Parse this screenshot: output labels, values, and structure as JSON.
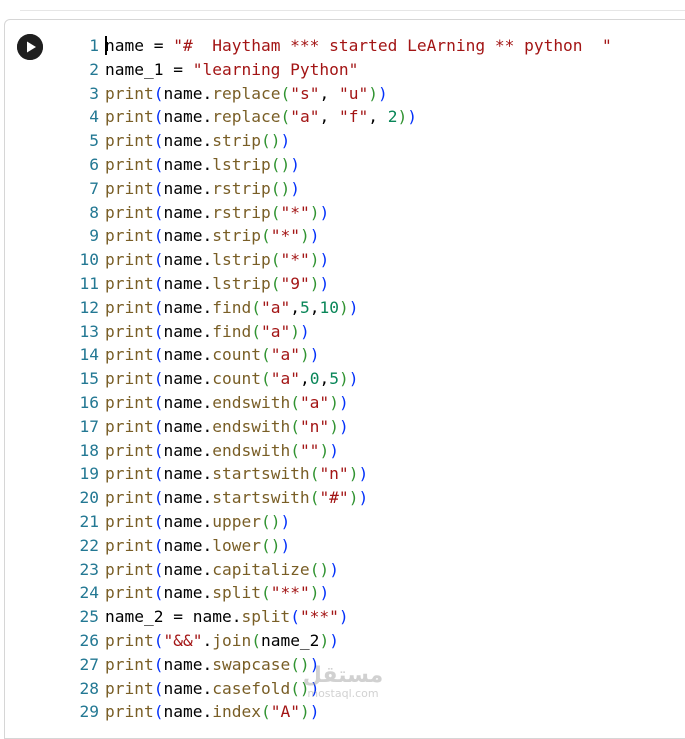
{
  "cell": {
    "run_button_icon": "play-circle-icon",
    "lines": [
      {
        "num": "1",
        "tokens": [
          [
            "plain",
            "name = "
          ],
          [
            "str",
            "\"#  Haytham *** started LeArning ** python  \""
          ]
        ]
      },
      {
        "num": "2",
        "tokens": [
          [
            "plain",
            "name_1 = "
          ],
          [
            "str",
            "\"learning Python\""
          ]
        ]
      },
      {
        "num": "3",
        "tokens": [
          [
            "fn",
            "print"
          ],
          [
            "p1",
            "("
          ],
          [
            "plain",
            "name."
          ],
          [
            "fn",
            "replace"
          ],
          [
            "p2",
            "("
          ],
          [
            "str",
            "\"s\""
          ],
          [
            "plain",
            ", "
          ],
          [
            "str",
            "\"u\""
          ],
          [
            "p2",
            ")"
          ],
          [
            "p1",
            ")"
          ]
        ]
      },
      {
        "num": "4",
        "tokens": [
          [
            "fn",
            "print"
          ],
          [
            "p1",
            "("
          ],
          [
            "plain",
            "name."
          ],
          [
            "fn",
            "replace"
          ],
          [
            "p2",
            "("
          ],
          [
            "str",
            "\"a\""
          ],
          [
            "plain",
            ", "
          ],
          [
            "str",
            "\"f\""
          ],
          [
            "plain",
            ", "
          ],
          [
            "num",
            "2"
          ],
          [
            "p2",
            ")"
          ],
          [
            "p1",
            ")"
          ]
        ]
      },
      {
        "num": "5",
        "tokens": [
          [
            "fn",
            "print"
          ],
          [
            "p1",
            "("
          ],
          [
            "plain",
            "name."
          ],
          [
            "fn",
            "strip"
          ],
          [
            "p2",
            "()"
          ],
          [
            "p1",
            ")"
          ]
        ]
      },
      {
        "num": "6",
        "tokens": [
          [
            "fn",
            "print"
          ],
          [
            "p1",
            "("
          ],
          [
            "plain",
            "name."
          ],
          [
            "fn",
            "lstrip"
          ],
          [
            "p2",
            "()"
          ],
          [
            "p1",
            ")"
          ]
        ]
      },
      {
        "num": "7",
        "tokens": [
          [
            "fn",
            "print"
          ],
          [
            "p1",
            "("
          ],
          [
            "plain",
            "name."
          ],
          [
            "fn",
            "rstrip"
          ],
          [
            "p2",
            "()"
          ],
          [
            "p1",
            ")"
          ]
        ]
      },
      {
        "num": "8",
        "tokens": [
          [
            "fn",
            "print"
          ],
          [
            "p1",
            "("
          ],
          [
            "plain",
            "name."
          ],
          [
            "fn",
            "rstrip"
          ],
          [
            "p2",
            "("
          ],
          [
            "str",
            "\"*\""
          ],
          [
            "p2",
            ")"
          ],
          [
            "p1",
            ")"
          ]
        ]
      },
      {
        "num": "9",
        "tokens": [
          [
            "fn",
            "print"
          ],
          [
            "p1",
            "("
          ],
          [
            "plain",
            "name."
          ],
          [
            "fn",
            "strip"
          ],
          [
            "p2",
            "("
          ],
          [
            "str",
            "\"*\""
          ],
          [
            "p2",
            ")"
          ],
          [
            "p1",
            ")"
          ]
        ]
      },
      {
        "num": "10",
        "tokens": [
          [
            "fn",
            "print"
          ],
          [
            "p1",
            "("
          ],
          [
            "plain",
            "name."
          ],
          [
            "fn",
            "lstrip"
          ],
          [
            "p2",
            "("
          ],
          [
            "str",
            "\"*\""
          ],
          [
            "p2",
            ")"
          ],
          [
            "p1",
            ")"
          ]
        ]
      },
      {
        "num": "11",
        "tokens": [
          [
            "fn",
            "print"
          ],
          [
            "p1",
            "("
          ],
          [
            "plain",
            "name."
          ],
          [
            "fn",
            "lstrip"
          ],
          [
            "p2",
            "("
          ],
          [
            "str",
            "\"9\""
          ],
          [
            "p2",
            ")"
          ],
          [
            "p1",
            ")"
          ]
        ]
      },
      {
        "num": "12",
        "tokens": [
          [
            "fn",
            "print"
          ],
          [
            "p1",
            "("
          ],
          [
            "plain",
            "name."
          ],
          [
            "fn",
            "find"
          ],
          [
            "p2",
            "("
          ],
          [
            "str",
            "\"a\""
          ],
          [
            "plain",
            ","
          ],
          [
            "num",
            "5"
          ],
          [
            "plain",
            ","
          ],
          [
            "num",
            "10"
          ],
          [
            "p2",
            ")"
          ],
          [
            "p1",
            ")"
          ]
        ]
      },
      {
        "num": "13",
        "tokens": [
          [
            "fn",
            "print"
          ],
          [
            "p1",
            "("
          ],
          [
            "plain",
            "name."
          ],
          [
            "fn",
            "find"
          ],
          [
            "p2",
            "("
          ],
          [
            "str",
            "\"a\""
          ],
          [
            "p2",
            ")"
          ],
          [
            "p1",
            ")"
          ]
        ]
      },
      {
        "num": "14",
        "tokens": [
          [
            "fn",
            "print"
          ],
          [
            "p1",
            "("
          ],
          [
            "plain",
            "name."
          ],
          [
            "fn",
            "count"
          ],
          [
            "p2",
            "("
          ],
          [
            "str",
            "\"a\""
          ],
          [
            "p2",
            ")"
          ],
          [
            "p1",
            ")"
          ]
        ]
      },
      {
        "num": "15",
        "tokens": [
          [
            "fn",
            "print"
          ],
          [
            "p1",
            "("
          ],
          [
            "plain",
            "name."
          ],
          [
            "fn",
            "count"
          ],
          [
            "p2",
            "("
          ],
          [
            "str",
            "\"a\""
          ],
          [
            "plain",
            ","
          ],
          [
            "num",
            "0"
          ],
          [
            "plain",
            ","
          ],
          [
            "num",
            "5"
          ],
          [
            "p2",
            ")"
          ],
          [
            "p1",
            ")"
          ]
        ]
      },
      {
        "num": "16",
        "tokens": [
          [
            "fn",
            "print"
          ],
          [
            "p1",
            "("
          ],
          [
            "plain",
            "name."
          ],
          [
            "fn",
            "endswith"
          ],
          [
            "p2",
            "("
          ],
          [
            "str",
            "\"a\""
          ],
          [
            "p2",
            ")"
          ],
          [
            "p1",
            ")"
          ]
        ]
      },
      {
        "num": "17",
        "tokens": [
          [
            "fn",
            "print"
          ],
          [
            "p1",
            "("
          ],
          [
            "plain",
            "name."
          ],
          [
            "fn",
            "endswith"
          ],
          [
            "p2",
            "("
          ],
          [
            "str",
            "\"n\""
          ],
          [
            "p2",
            ")"
          ],
          [
            "p1",
            ")"
          ]
        ]
      },
      {
        "num": "18",
        "tokens": [
          [
            "fn",
            "print"
          ],
          [
            "p1",
            "("
          ],
          [
            "plain",
            "name."
          ],
          [
            "fn",
            "endswith"
          ],
          [
            "p2",
            "("
          ],
          [
            "str",
            "\"\""
          ],
          [
            "p2",
            ")"
          ],
          [
            "p1",
            ")"
          ]
        ]
      },
      {
        "num": "19",
        "tokens": [
          [
            "fn",
            "print"
          ],
          [
            "p1",
            "("
          ],
          [
            "plain",
            "name."
          ],
          [
            "fn",
            "startswith"
          ],
          [
            "p2",
            "("
          ],
          [
            "str",
            "\"n\""
          ],
          [
            "p2",
            ")"
          ],
          [
            "p1",
            ")"
          ]
        ]
      },
      {
        "num": "20",
        "tokens": [
          [
            "fn",
            "print"
          ],
          [
            "p1",
            "("
          ],
          [
            "plain",
            "name."
          ],
          [
            "fn",
            "startswith"
          ],
          [
            "p2",
            "("
          ],
          [
            "str",
            "\"#\""
          ],
          [
            "p2",
            ")"
          ],
          [
            "p1",
            ")"
          ]
        ]
      },
      {
        "num": "21",
        "tokens": [
          [
            "fn",
            "print"
          ],
          [
            "p1",
            "("
          ],
          [
            "plain",
            "name."
          ],
          [
            "fn",
            "upper"
          ],
          [
            "p2",
            "()"
          ],
          [
            "p1",
            ")"
          ]
        ]
      },
      {
        "num": "22",
        "tokens": [
          [
            "fn",
            "print"
          ],
          [
            "p1",
            "("
          ],
          [
            "plain",
            "name."
          ],
          [
            "fn",
            "lower"
          ],
          [
            "p2",
            "()"
          ],
          [
            "p1",
            ")"
          ]
        ]
      },
      {
        "num": "23",
        "tokens": [
          [
            "fn",
            "print"
          ],
          [
            "p1",
            "("
          ],
          [
            "plain",
            "name."
          ],
          [
            "fn",
            "capitalize"
          ],
          [
            "p2",
            "()"
          ],
          [
            "p1",
            ")"
          ]
        ]
      },
      {
        "num": "24",
        "tokens": [
          [
            "fn",
            "print"
          ],
          [
            "p1",
            "("
          ],
          [
            "plain",
            "name."
          ],
          [
            "fn",
            "split"
          ],
          [
            "p2",
            "("
          ],
          [
            "str",
            "\"**\""
          ],
          [
            "p2",
            ")"
          ],
          [
            "p1",
            ")"
          ]
        ]
      },
      {
        "num": "25",
        "tokens": [
          [
            "plain",
            "name_2 = name."
          ],
          [
            "fn",
            "split"
          ],
          [
            "p1",
            "("
          ],
          [
            "str",
            "\"**\""
          ],
          [
            "p1",
            ")"
          ]
        ]
      },
      {
        "num": "26",
        "tokens": [
          [
            "fn",
            "print"
          ],
          [
            "p1",
            "("
          ],
          [
            "str",
            "\"&&\""
          ],
          [
            "plain",
            "."
          ],
          [
            "fn",
            "join"
          ],
          [
            "p2",
            "("
          ],
          [
            "plain",
            "name_2"
          ],
          [
            "p2",
            ")"
          ],
          [
            "p1",
            ")"
          ]
        ]
      },
      {
        "num": "27",
        "tokens": [
          [
            "fn",
            "print"
          ],
          [
            "p1",
            "("
          ],
          [
            "plain",
            "name."
          ],
          [
            "fn",
            "swapcase"
          ],
          [
            "p2",
            "()"
          ],
          [
            "p1",
            ")"
          ]
        ]
      },
      {
        "num": "28",
        "tokens": [
          [
            "fn",
            "print"
          ],
          [
            "p1",
            "("
          ],
          [
            "plain",
            "name."
          ],
          [
            "fn",
            "casefold"
          ],
          [
            "p2",
            "()"
          ],
          [
            "p1",
            ")"
          ]
        ]
      },
      {
        "num": "29",
        "tokens": [
          [
            "fn",
            "print"
          ],
          [
            "p1",
            "("
          ],
          [
            "plain",
            "name."
          ],
          [
            "fn",
            "index"
          ],
          [
            "p2",
            "("
          ],
          [
            "str",
            "\"A\""
          ],
          [
            "p2",
            ")"
          ],
          [
            "p1",
            ")"
          ]
        ]
      }
    ]
  },
  "watermark": {
    "arabic": "مستقل",
    "latin": "mostaql.com"
  }
}
